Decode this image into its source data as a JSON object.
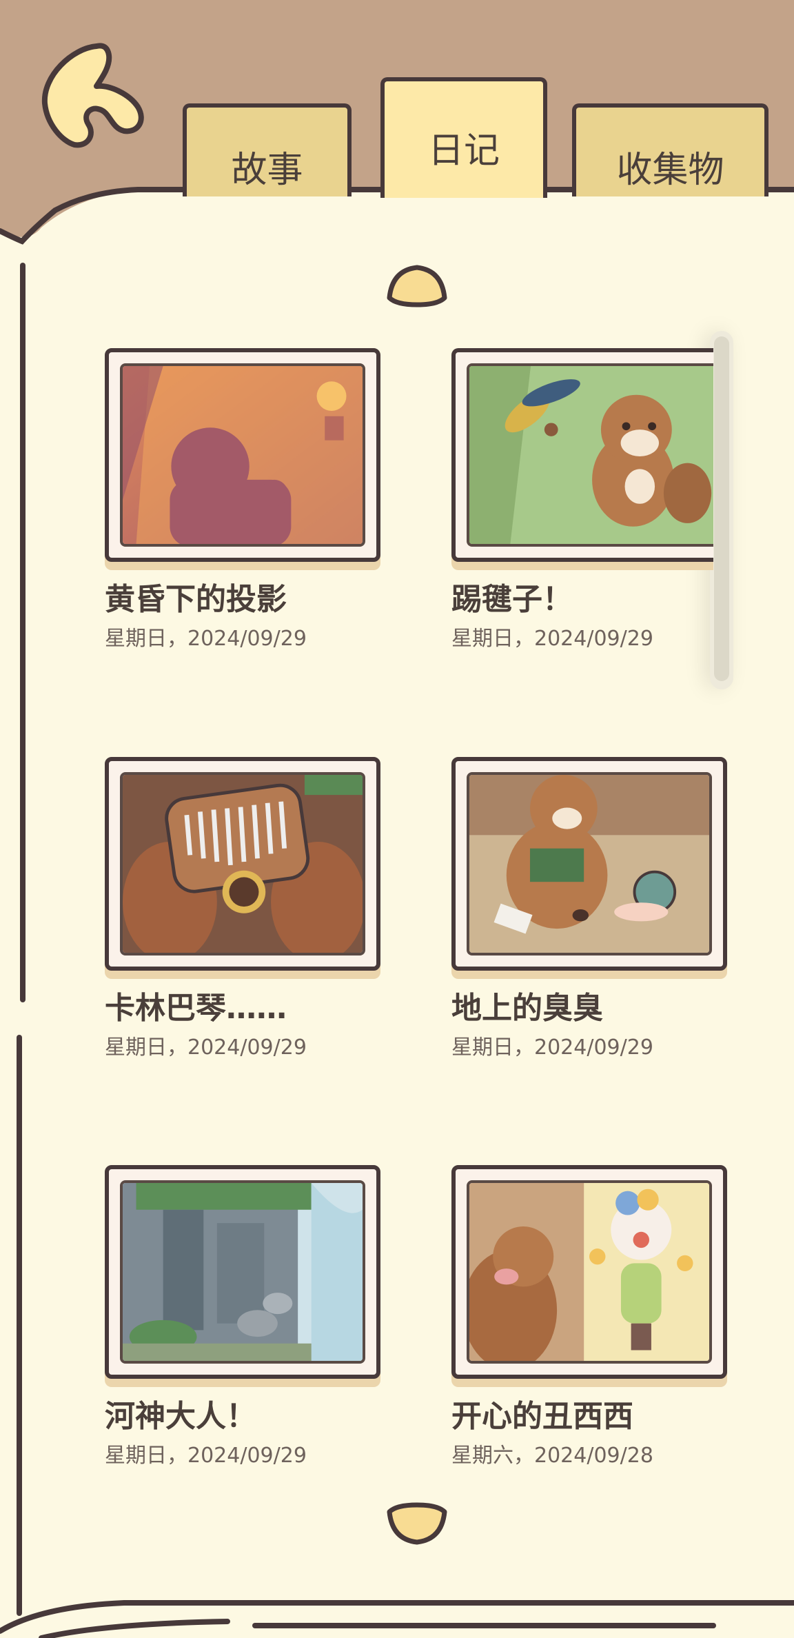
{
  "tabs": {
    "story": "故事",
    "diary": "日记",
    "collection": "收集物"
  },
  "selected_tab": "diary",
  "diary_entries": [
    {
      "title": "黄昏下的投影",
      "date": "星期日，2024/09/29"
    },
    {
      "title": "踢毽子！",
      "date": "星期日，2024/09/29"
    },
    {
      "title": "卡林巴琴……",
      "date": "星期日，2024/09/29"
    },
    {
      "title": "地上的臭臭",
      "date": "星期日，2024/09/29"
    },
    {
      "title": "河神大人！",
      "date": "星期日，2024/09/29"
    },
    {
      "title": "开心的丑西西",
      "date": "星期六，2024/09/28"
    }
  ],
  "icons": {
    "back": "back-arrow-icon",
    "up": "scroll-up-icon",
    "down": "scroll-down-icon"
  },
  "colors": {
    "background": "#c3a389",
    "paper": "#fdf9e3",
    "tab": "#e9d38f",
    "tab_active": "#fde9a8",
    "outline": "#47393a",
    "text": "#4a3f3a"
  }
}
